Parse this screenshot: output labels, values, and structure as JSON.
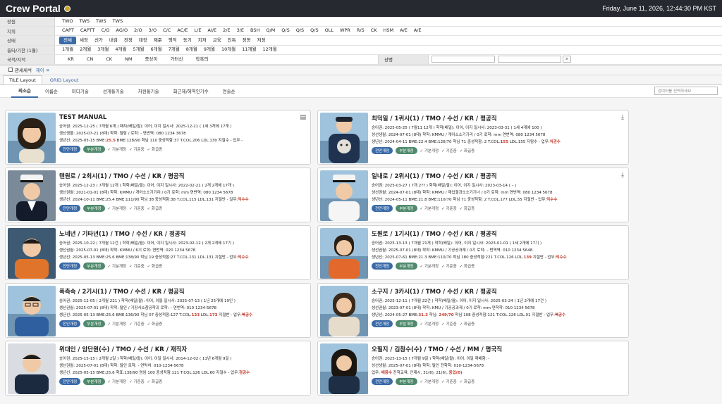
{
  "app": {
    "title": "Crew Portal",
    "datetime": "Friday, June 11, 2026, 12:44:30 PM KST"
  },
  "filters": [
    {
      "label": "장원",
      "options": [
        "TWO",
        "TWS",
        "TWS",
        "TWS"
      ],
      "selected": -1
    },
    {
      "label": "지위",
      "options": [
        "CAPT",
        "CAPTT",
        "C/O",
        "AG/O",
        "2/O",
        "3/O",
        "C/C",
        "AC/E",
        "L/E",
        "AI/E",
        "2/E",
        "3/E",
        "BSH",
        "Q/M",
        "Q/S",
        "Q/S",
        "Q/S",
        "OLL",
        "WPR",
        "R/S",
        "CK",
        "HSM",
        "A/E",
        "A/E"
      ],
      "selected": -1
    },
    {
      "label": "상태",
      "options": [
        "전체",
        "세장",
        "선가",
        "내검",
        "전정",
        "대장",
        "제준",
        "행적",
        "동기",
        "지저",
        "교육",
        "진특",
        "정봉",
        "저정"
      ],
      "selected": 0
    },
    {
      "label": "출타/기한 (1월)",
      "options": [
        "1개월",
        "2개월",
        "3개월",
        "4개월",
        "5개월",
        "6개월",
        "7개월",
        "8개월",
        "9개월",
        "10개월",
        "11개월",
        "12개월"
      ],
      "selected": -1
    }
  ],
  "nationality_row": {
    "label": "국적/지적",
    "options": [
      "KR",
      "CN",
      "CK",
      "NM",
      "증상이",
      "가터신",
      "학혹의"
    ],
    "status_label": "상병",
    "search_icon": "search-icon"
  },
  "subbar": {
    "checkbox_label": "관세세석",
    "chip_label": "재이"
  },
  "layout_tabs": [
    "TILE Layout",
    "GRID Layout"
  ],
  "sort_tabs": [
    "최소순",
    "이름순",
    "미디기술",
    "선개통기술",
    "차원통기술",
    "회근제/해역인기수",
    "연술순"
  ],
  "filter_placeholder": "감여어를 진력하세요",
  "crew": [
    {
      "name": "TEST MANUAL",
      "icon": "document-icon",
      "photo": "avatar-young-woman",
      "l1": "승어권: 2025-12-25 ( 7개월 6개 )  패치(배일/팔): 이어, 이지  일시사: 2025-12-21 ( 1세 3개에 17개 )",
      "l2": "생선생물: 2025-07-21 (8데)  학학: 탈탐 / 로학: -   연번역: 080 1234 3678",
      "l3a": "생년선: 2025-05-15  BME:",
      "l3red": "25.5",
      "l3b": " BME:128/90  학님 110  중성적함:37  T.COL.206  LDL.130  지절수 - 업무 -",
      "l3tail": "",
      "p1": "전만개정",
      "p2": "부분개정",
      "c1": "기분개정",
      "c2": "기준중",
      "c3": "화급증"
    },
    {
      "name": "최덕일 / 1퀴시(1) / TMO / 수선 / KR / 평공직",
      "icon": "download-icon",
      "photo": "avatar-man-dog",
      "l1": "승어권: 2025-05-25 ( 7월11 12개 )  학학(배일): 이어, 이지  일시사: 2023-03-31 ( 1세 4개에 100 )",
      "l2": "성선생월: 2024-07-01 (8데)  학학: KMMU / 개어소소기기리 / 0기  로학: mm  연번역: 080 1234 5678",
      "l3a": "생년선: 2024-04-11  BME:22.4  BME:126/70  학님 71  중성적함: 2  T.COL.",
      "l3red": "155",
      "l3b": "  LDL.155  지탐수 -  업무:",
      "l3tail": "익관수",
      "p1": "전만개정",
      "p2": "부분개정",
      "c1": "기분개정",
      "c2": "기준중",
      "c3": "화급증"
    },
    {
      "name": "텐원로 / 2최시(1) / TMO / 수선 / KR / 평공직",
      "icon": "",
      "photo": "avatar-captain",
      "l1": "승어권: 2025-12-23 ( 7개월 12개 )  학학(배일/팔): 이어, 이지  일시사: 2022-02-21 ( 2개 2개에 17개 )",
      "l2": "생선권월: 2021-01-01 (8데)  학학: KMMU / 개어소소기기리 / 0기  로학: mm  연번역: 080 1234 5678",
      "l3a": "생년선: 2024-10-11  BME:25.4  BME:111/90  학님 38  중성적함:38  T.COL.115  LDL.131  지절반 -  일무:",
      "l3red": "",
      "l3b": "",
      "l3tail": "익수수",
      "p1": "전만개정",
      "p2": "부분개정",
      "c1": "기분개정",
      "c2": "기준중",
      "c3": "화급증"
    },
    {
      "name": "일내로 / 2위시(1) / TMO / 수선 / KR / 평공직",
      "icon": "download-icon",
      "photo": "avatar-officer-white",
      "l1": "승어권: 2025-03-27 ( 7개 2?? )  학학(배일/팔): 이어, 이지  일시사: 2023-03-14 ( – )",
      "l2": "생선권월: 2024-07-01 (8데)  학학: KMMU / 재업결과소소기기너 / 0기  로학: mm  연번역: 080 1234 5678",
      "l3a": "생년선: 2024-05-11  BME:21.8  BME:110/70  학님 71  중성적함: 2  T.COL.177  LDL.55  지절반 -  업무:",
      "l3red": "",
      "l3b": "",
      "l3tail": "익수수",
      "p1": "전만개정",
      "p2": "부분개정",
      "c1": "기분개정",
      "c2": "기준중",
      "c3": "화급증"
    },
    {
      "name": "노네년 / 기타년(1) / TMO / 수선 / KR / 정공직",
      "icon": "",
      "photo": "avatar-man-orange",
      "l1": "승어권: 2025-10-22 ( 7개월 12건 )  학학(배일/월): 이어, 이지  일시사: 2023-02-12 ( 2개 2개에 17기 )",
      "l2": "생선권월: 2025-07-01 (8데)  학학: KMMU / 6기  로학:   연번역: 020 1234 5678",
      "l3a": "생년선: 2025-05-13  BME:25.6  BME:138/90  학님 19  중성적함:27  T.COL.131  LDL.131  지절반 -  업무:",
      "l3red": "",
      "l3b": "",
      "l3tail": "익수수",
      "p1": "전만개정",
      "p2": "부분개정",
      "c1": "기분개정",
      "c2": "기준중",
      "c3": "화급증"
    },
    {
      "name": "도원로 / 1기시(1) / TMO / 수선 / KR / 평공직",
      "icon": "",
      "photo": "avatar-woman-orange",
      "l1": "승어권: 2025-13-13 ( 7개월 21개 )  학학(배일): 이어, 이지  일시사: 2023-01-01 ( 1세 2개에 17기 )",
      "l2": "생선권월: 2025-07-01 (8데)  학학: KMMU / 기공공과재 / 0기  로학: –  번역역: 010 1234 5648",
      "l3a": "생년선: 2025-07-61  BME:21.3  BME:110/70  학님 180  중성적함:221  T.COL.126  LDL.",
      "l3red": "139",
      "l3b": "  지절반 -  업무:",
      "l3tail": "익수수",
      "p1": "전인개정",
      "p2": "부분개정",
      "c1": "기분개정",
      "c2": "기준중",
      "c3": "화급증"
    },
    {
      "name": "폭측속 / 2기시(1) / TMO / 수선 / KR / 평공직",
      "icon": "",
      "photo": "avatar-man-glasses",
      "l1": "승어권: 2025-12-05 ( 2개월 221 )  학학(배일/팔): 이어, 이들  일시사: 2025-07-13 ( 1년 25개에 19인 )",
      "l2": "생선권월: 2025-07-01 (8데)  학학: 탈인 / 기장사소참공학괴  로학: –  연번역: 010-1234-5678",
      "l3a": "생년선: 2025-05-13  BME:25.6  BME:136/90  학님 07  중성적함:127  T.COL.",
      "l3red": "123",
      "l3b": "  LDL.",
      "l3tail": "173",
      "l3extra": "  지절반 -  업무:",
      "l3last": "북공수",
      "p1": "진인개정",
      "p2": "부분개정",
      "c1": "기분개정",
      "c2": "기준중",
      "c3": "화급증"
    },
    {
      "name": "소구지 / 3카시(1) / TMO / 수선 / KR / 평공직",
      "icon": "",
      "photo": "avatar-woman-smile",
      "l1": "승어권: 2025-12-11 ( 7개월 22건 )  학학(배일/월): 이어, 이지  일시사: 2025-03-24 ( 1년 2개에 17건 )",
      "l2": "생선권월: 2023-07-01 (8데)  학학: KMU / 기공공과재 / 0기  로학: mm  연학학: 010 1234 5678",
      "l3a": "생년선: 2024-05-27  BME:",
      "l3red": "31.3",
      "l3b": "  학님: ",
      "l3tail": "249/70",
      "l3extra": "  학님 108  중성적함:121  T.COL.126  LDL.01  지절반 -  업무:",
      "l3last": "북공수",
      "p1": "전인개정",
      "p2": "부분개정",
      "c1": "기분개정",
      "c2": "기준중",
      "c3": "화급증"
    },
    {
      "name": "위대인 / 암단원(수) / TMO / 수선 / KR / 재직자",
      "icon": "",
      "photo": "avatar-young-man",
      "l1": "승어권: 2025-15-15 ( 2개월 2일 )  학학(배일/팔): 이어, 이일  일시사: 2014-12-02 ( 11년 6개월 9일 )",
      "l2": "생선권월: 2025-07-01 (8데)  학학: 탈인 로학: -   연락처: 010-1234-5678",
      "l3a": "생년선: 2025-05-15  BME:25.6  학표:138/90  영임 100  중성적함:121  T.COL.126  LDL.60  지절수 - 업무:",
      "l3red": "",
      "l3b": "",
      "l3tail": "정공수",
      "p1": "전만개정",
      "p2": "부분개정",
      "c1": "기분개정",
      "c2": "기준중",
      "c3": "화급증"
    },
    {
      "name": "오필지 / 김참수(수) / TMO / 수선 / MM / 평국직",
      "icon": "",
      "photo": "avatar-woman-hair",
      "l1": "승어권: 2025-13-15 ( 7개월 9일 )  학학(배일/팔): 이어, 이일  재배함: -",
      "l2": "성선생월: 2025-07-01 (8데)  학학: 탈인  전학학: 010-1234-5678",
      "l3a": "업무: ",
      "l3red": "배음수",
      "l3b": "  진학교육, 인재시, 31(6), 21(6), ",
      "l3tail": "동입(0)",
      "p1": "전만개정",
      "p2": "부분개정",
      "c1": "기분개정",
      "c2": "기준중",
      "c3": "화급증"
    }
  ]
}
